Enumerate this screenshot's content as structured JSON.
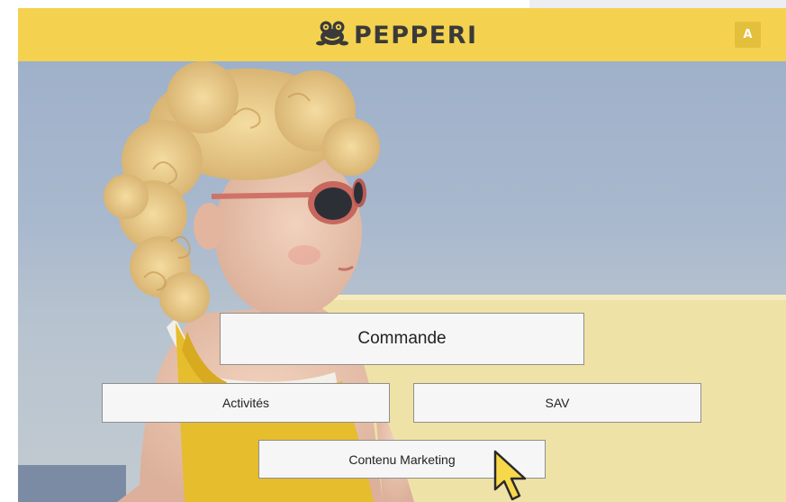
{
  "header": {
    "brand": "PEPPERI",
    "logo_icon": "frog-icon",
    "user_initial": "A",
    "color": "#f4d24f"
  },
  "hero": {
    "image": "child-with-sunglasses-photo"
  },
  "menu": {
    "commande": "Commande",
    "activites": "Activités",
    "sav": "SAV",
    "contenu_marketing": "Contenu Marketing"
  },
  "cursor": "pointer-arrow-icon"
}
